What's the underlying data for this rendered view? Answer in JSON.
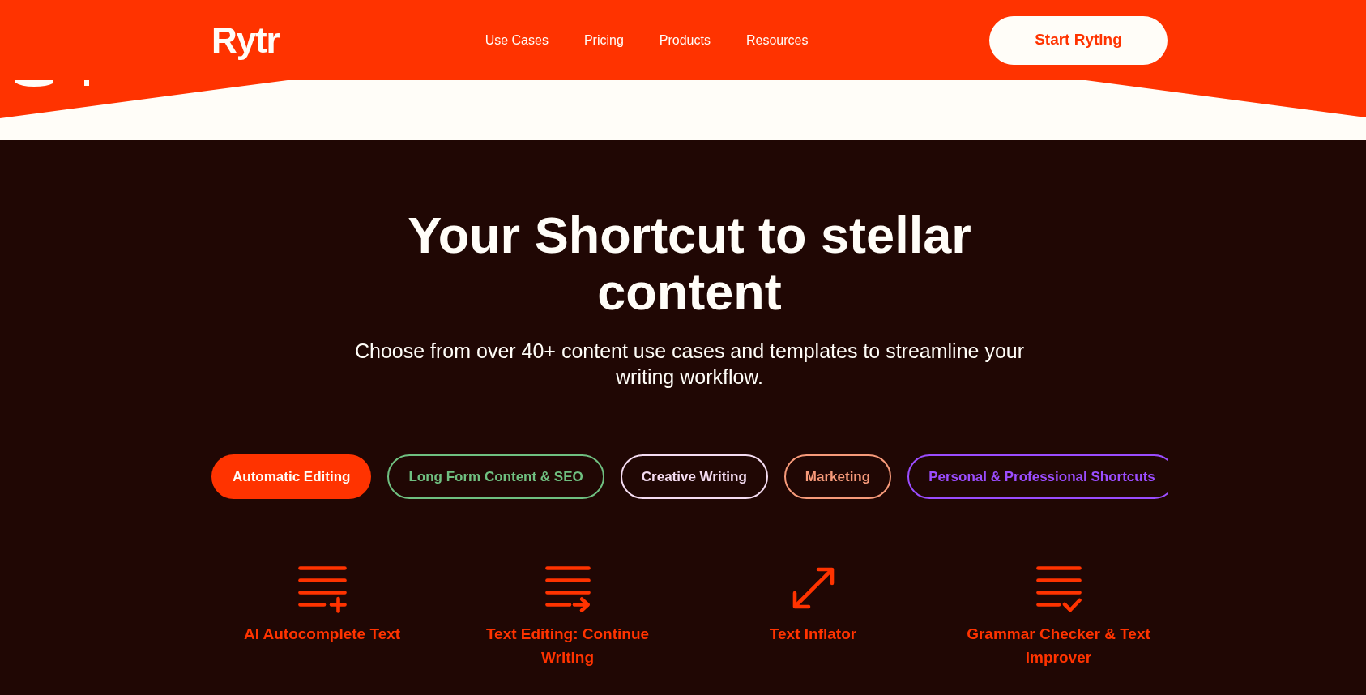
{
  "header": {
    "logo": "Rytr",
    "nav": [
      "Use Cases",
      "Pricing",
      "Products",
      "Resources"
    ],
    "cta": "Start Ryting"
  },
  "hero": {
    "title": "Your Shortcut to stellar content",
    "subtitle": "Choose from over 40+ content use cases and templates to streamline your writing workflow."
  },
  "categories": [
    {
      "label": "Automatic Editing",
      "selected": true,
      "color": "#ff3300"
    },
    {
      "label": "Long Form Content & SEO",
      "selected": false,
      "color": "#6fbf80"
    },
    {
      "label": "Creative Writing",
      "selected": false,
      "color": "#f5dcf2"
    },
    {
      "label": "Marketing",
      "selected": false,
      "color": "#f79a7a"
    },
    {
      "label": "Personal & Professional Shortcuts",
      "selected": false,
      "color": "#9b4dff"
    }
  ],
  "tools": [
    {
      "kind": "append",
      "label": "AI Autocomplete Text"
    },
    {
      "kind": "continue",
      "label": "Text Editing: Continue Writing"
    },
    {
      "kind": "expand",
      "label": "Text Inflator"
    },
    {
      "kind": "check",
      "label": "Grammar Checker & Text Improver"
    }
  ]
}
